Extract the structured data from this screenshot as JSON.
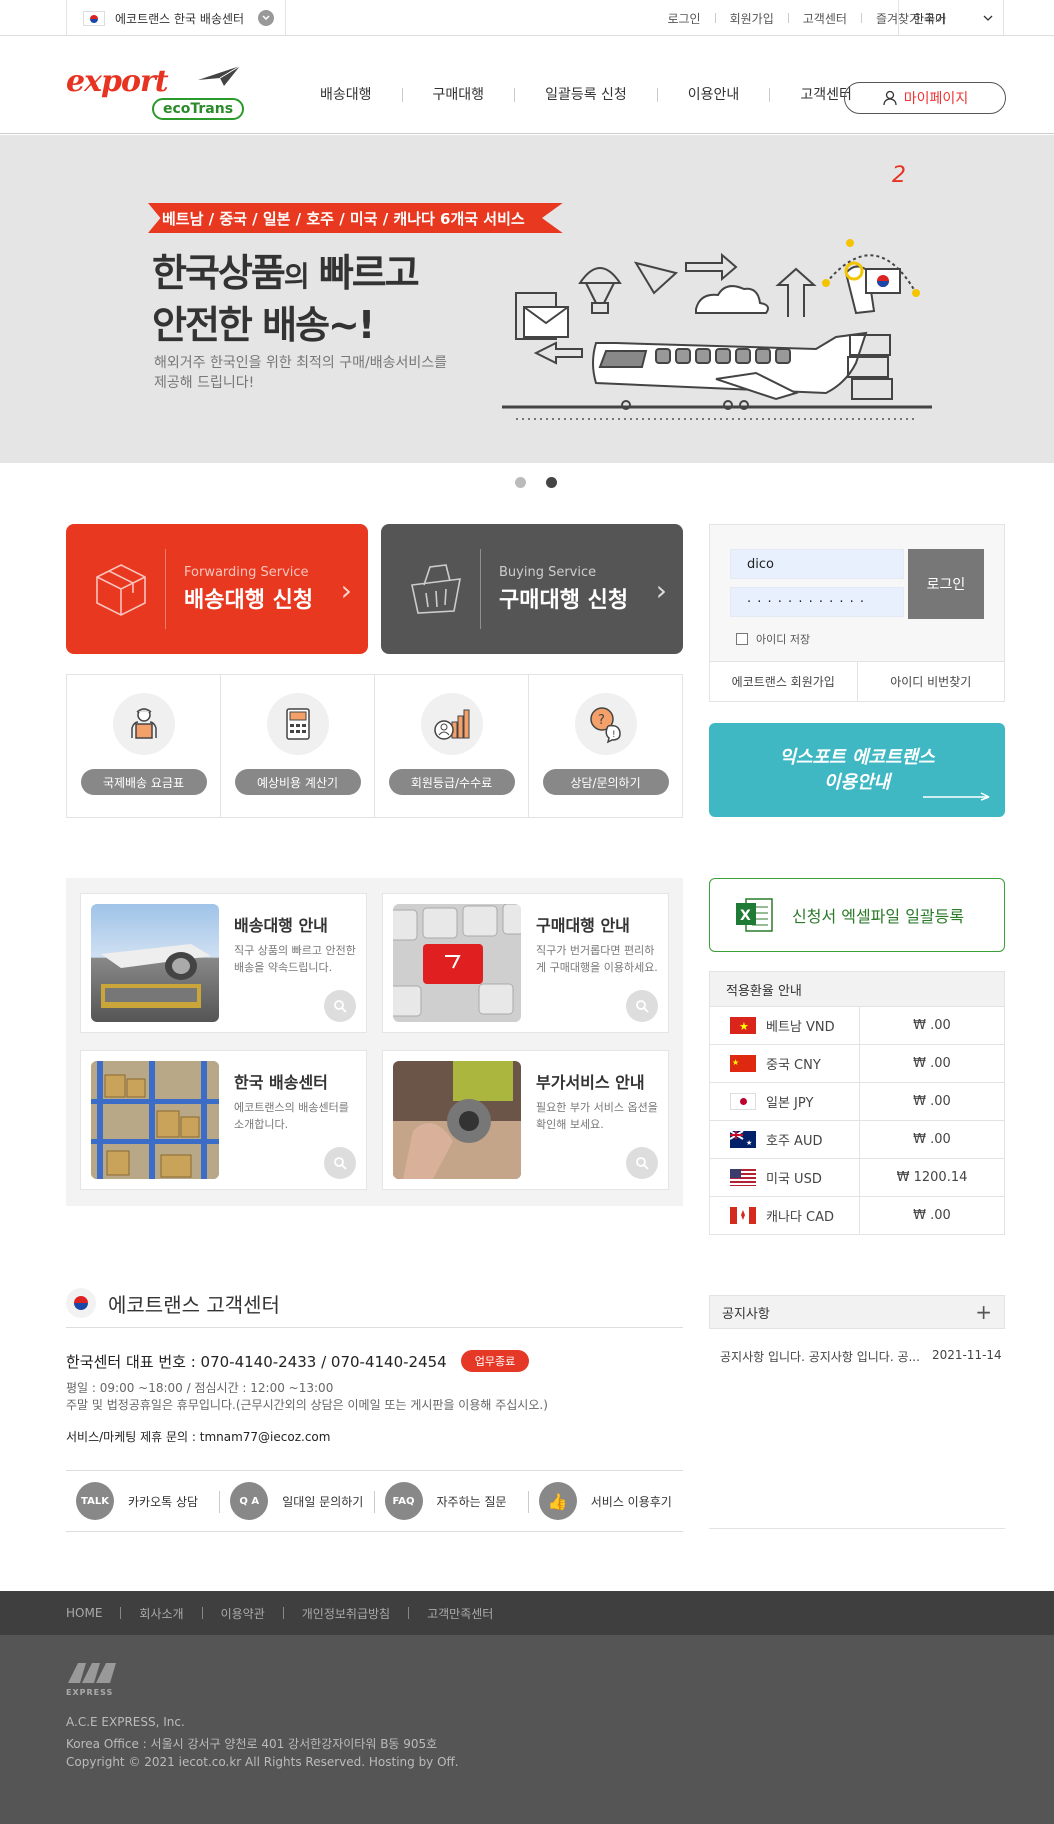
{
  "topbar": {
    "center_label": "에코트랜스 한국 배송센터",
    "links": [
      "로그인",
      "회원가입",
      "고객센터",
      "즐겨찾기 추가"
    ],
    "language": "한국어"
  },
  "header": {
    "logo_main": "export",
    "logo_sub": "ecoTrans",
    "nav": [
      "배송대행",
      "구매대행",
      "일괄등록 신청",
      "이용안내",
      "고객센터"
    ],
    "mypage": "마이페이지"
  },
  "hero": {
    "slide_number": "2",
    "ribbon": "베트남 / 중국 / 일본 / 호주 / 미국 / 캐나다 6개국 서비스",
    "headline_1a": "한국상품",
    "headline_1b": "의",
    "headline_1c": " 빠르고",
    "headline_2": "안전한 배송~!",
    "desc_1": "해외거주 한국인을 위한 최적의 구매/배송서비스를",
    "desc_2": "제공해 드립니다!"
  },
  "services": [
    {
      "sub": "Forwarding Service",
      "main": "배송대행 신청",
      "color": "#e8381f"
    },
    {
      "sub": "Buying Service",
      "main": "구매대행 신청",
      "color": "#555555"
    }
  ],
  "quick": [
    {
      "label": "국제배송 요금표",
      "icon": "courier-icon"
    },
    {
      "label": "예상비용 계산기",
      "icon": "calculator-icon"
    },
    {
      "label": "회원등급/수수료",
      "icon": "member-grade-icon"
    },
    {
      "label": "상담/문의하기",
      "icon": "inquiry-icon"
    }
  ],
  "login": {
    "username": "dico",
    "password_mask": "· · · · · · · · · · · ·",
    "button": "로그인",
    "remember": "아이디 저장",
    "join": "에코트랜스 회원가입",
    "find": "아이디 비번찾기"
  },
  "guide": {
    "line1": "익스포트 에코트랜스",
    "line2": "이용안내"
  },
  "info_cards": [
    {
      "title": "배송대행 안내",
      "desc": "직구 상품의 빠르고 안전한 배송을 약속드립니다."
    },
    {
      "title": "구매대행 안내",
      "desc": "직구가 번거롭다면 편리하게 구매대행을 이용하세요."
    },
    {
      "title": "한국 배송센터",
      "desc": "에코트랜스의 배송센터를 소개합니다."
    },
    {
      "title": "부가서비스 안내",
      "desc": "필요한 부가 서비스 옵션을 확인해 보세요."
    }
  ],
  "excel": {
    "label": "신청서 엑셀파일 일괄등록"
  },
  "rates": {
    "title": "적용환율 안내",
    "rows": [
      {
        "country": "베트남 VND",
        "value": "₩ .00",
        "flag": "vn"
      },
      {
        "country": "중국 CNY",
        "value": "₩ .00",
        "flag": "cn"
      },
      {
        "country": "일본 JPY",
        "value": "₩ .00",
        "flag": "jp"
      },
      {
        "country": "호주 AUD",
        "value": "₩ .00",
        "flag": "au"
      },
      {
        "country": "미국 USD",
        "value": "₩ 1200.14",
        "flag": "us"
      },
      {
        "country": "캐나다 CAD",
        "value": "₩ .00",
        "flag": "ca"
      }
    ]
  },
  "customer_center": {
    "title": "에코트랜스 고객센터",
    "tel": "한국센터 대표 번호 : 070-4140-2433 / 070-4140-2454",
    "status": "업무종료",
    "hours_1": "평일 : 09:00 ~18:00 / 점심시간 : 12:00 ~13:00",
    "hours_2": "주말 및 법정공휴일은 휴무입니다.(근무시간외의 상담은 이메일 또는 게시판을 이용해 주십시오.)",
    "partner": "서비스/마케팅 제휴 문의 : tmnam77@iecoz.com",
    "links": [
      {
        "label": "카카오톡 상담",
        "icon_text": "TALK"
      },
      {
        "label": "일대일 문의하기",
        "icon_text": "Q A"
      },
      {
        "label": "자주하는 질문",
        "icon_text": "FAQ"
      },
      {
        "label": "서비스 이용후기",
        "icon_text": "👍"
      }
    ]
  },
  "notice": {
    "title": "공지사항",
    "plus": "+",
    "item_text": "공지사항 입니다. 공지사항 입니다. 공...",
    "item_date": "2021-11-14"
  },
  "footer": {
    "nav": [
      "HOME",
      "회사소개",
      "이용약관",
      "개인정보취급방침",
      "고객만족센터"
    ],
    "logo_text": "EXPRESS",
    "company": "A.C.E EXPRESS, Inc.",
    "office": "Korea Office : 서울시 강서구 양천로 401 강서한강자이타워 B동 905호",
    "copyright": "Copyright © 2021 iecot.co.kr All Rights Reserved. Hosting by Off."
  }
}
